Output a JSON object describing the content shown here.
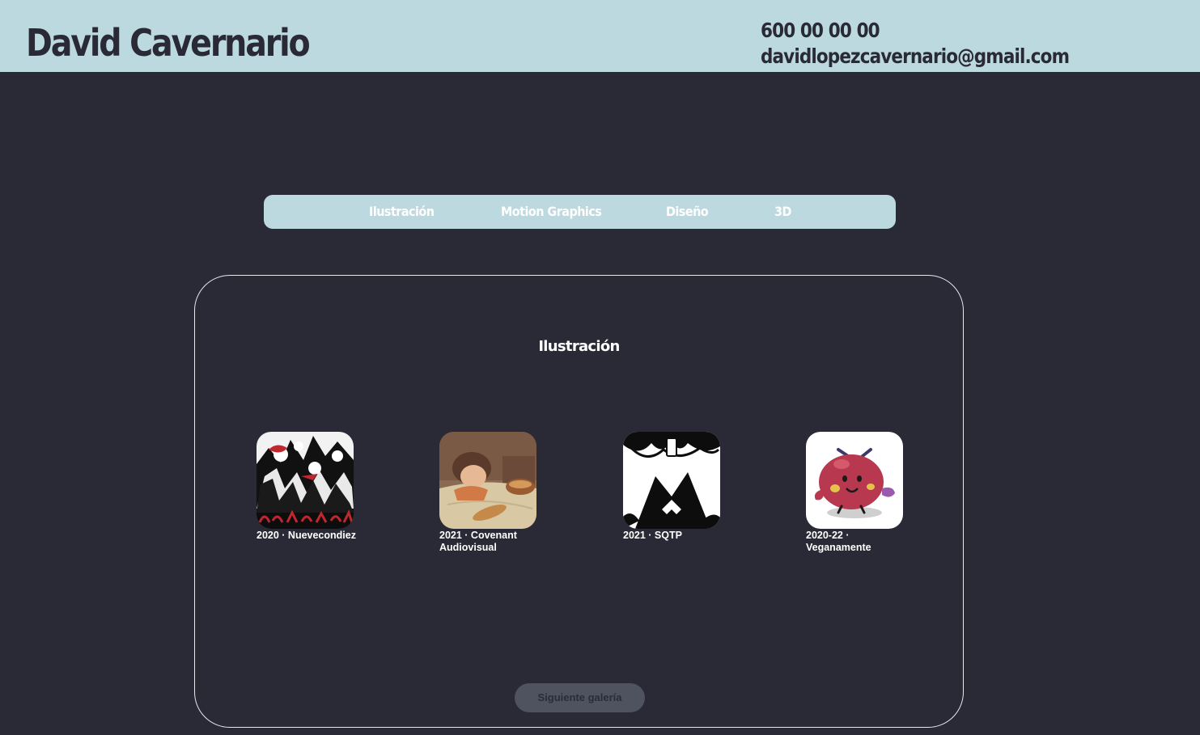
{
  "header": {
    "title": "David Cavernario",
    "phone": "600 00 00 00",
    "email": "davidlopezcavernario@gmail.com"
  },
  "nav": {
    "items": [
      {
        "label": "Ilustración"
      },
      {
        "label": "Motion Graphics"
      },
      {
        "label": "Diseño"
      },
      {
        "label": "3D"
      }
    ]
  },
  "gallery": {
    "title": "Ilustración",
    "items": [
      {
        "caption": "2020 · Nuevecondiez"
      },
      {
        "caption": "2021 · Covenant Audiovisual"
      },
      {
        "caption": "2021 · SQTP"
      },
      {
        "caption": "2020-22 · Veganamente"
      }
    ],
    "next_label": "Siguiente galería"
  },
  "colors": {
    "background": "#292a35",
    "header_bg": "#bcd9df",
    "nav_bg": "#bcd9df",
    "button_bg": "#4e535f"
  }
}
